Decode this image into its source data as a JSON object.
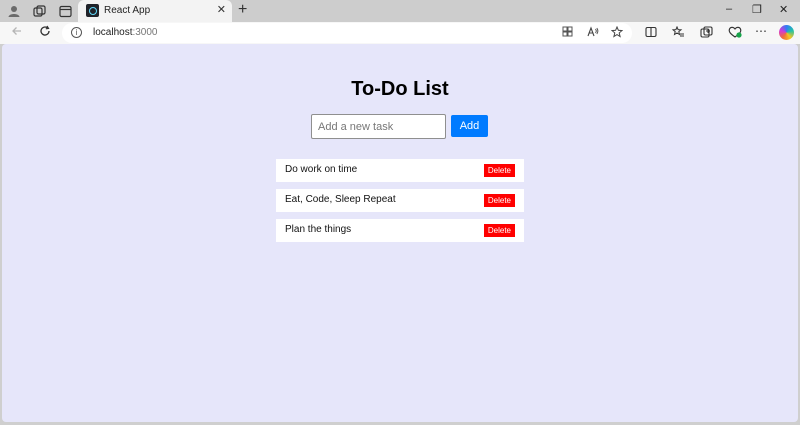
{
  "browser": {
    "tab_title": "React App",
    "tab_close": "✕",
    "new_tab": "+",
    "window_controls": {
      "minimize": "–",
      "restore": "❐",
      "close": "✕"
    },
    "address": {
      "host": "localhost",
      "port": ":3000"
    },
    "icons": {
      "profile": "profile-icon",
      "workspaces": "workspaces-icon",
      "tab_actions": "tab-actions-icon",
      "back": "back-arrow-icon",
      "refresh": "refresh-icon",
      "site_info": "info-icon",
      "app_available": "app-available-icon",
      "read_aloud": "read-aloud-icon",
      "favorite": "favorite-star-icon",
      "split_screen": "split-screen-icon",
      "favorites": "favorites-icon",
      "collections": "collections-icon",
      "browser_essentials": "browser-essentials-icon",
      "more": "more-icon",
      "copilot": "copilot-icon"
    }
  },
  "app": {
    "title": "To-Do List",
    "input": {
      "placeholder": "Add a new task",
      "value": ""
    },
    "add_label": "Add",
    "tasks": [
      {
        "text": "Do work on time",
        "delete_label": "Delete"
      },
      {
        "text": "Eat, Code, Sleep Repeat",
        "delete_label": "Delete"
      },
      {
        "text": "Plan the things",
        "delete_label": "Delete"
      }
    ]
  },
  "colors": {
    "page_background": "#e6e6fa",
    "add_button": "#007bff",
    "delete_button": "#ff0000",
    "task_background": "#ffffff"
  }
}
